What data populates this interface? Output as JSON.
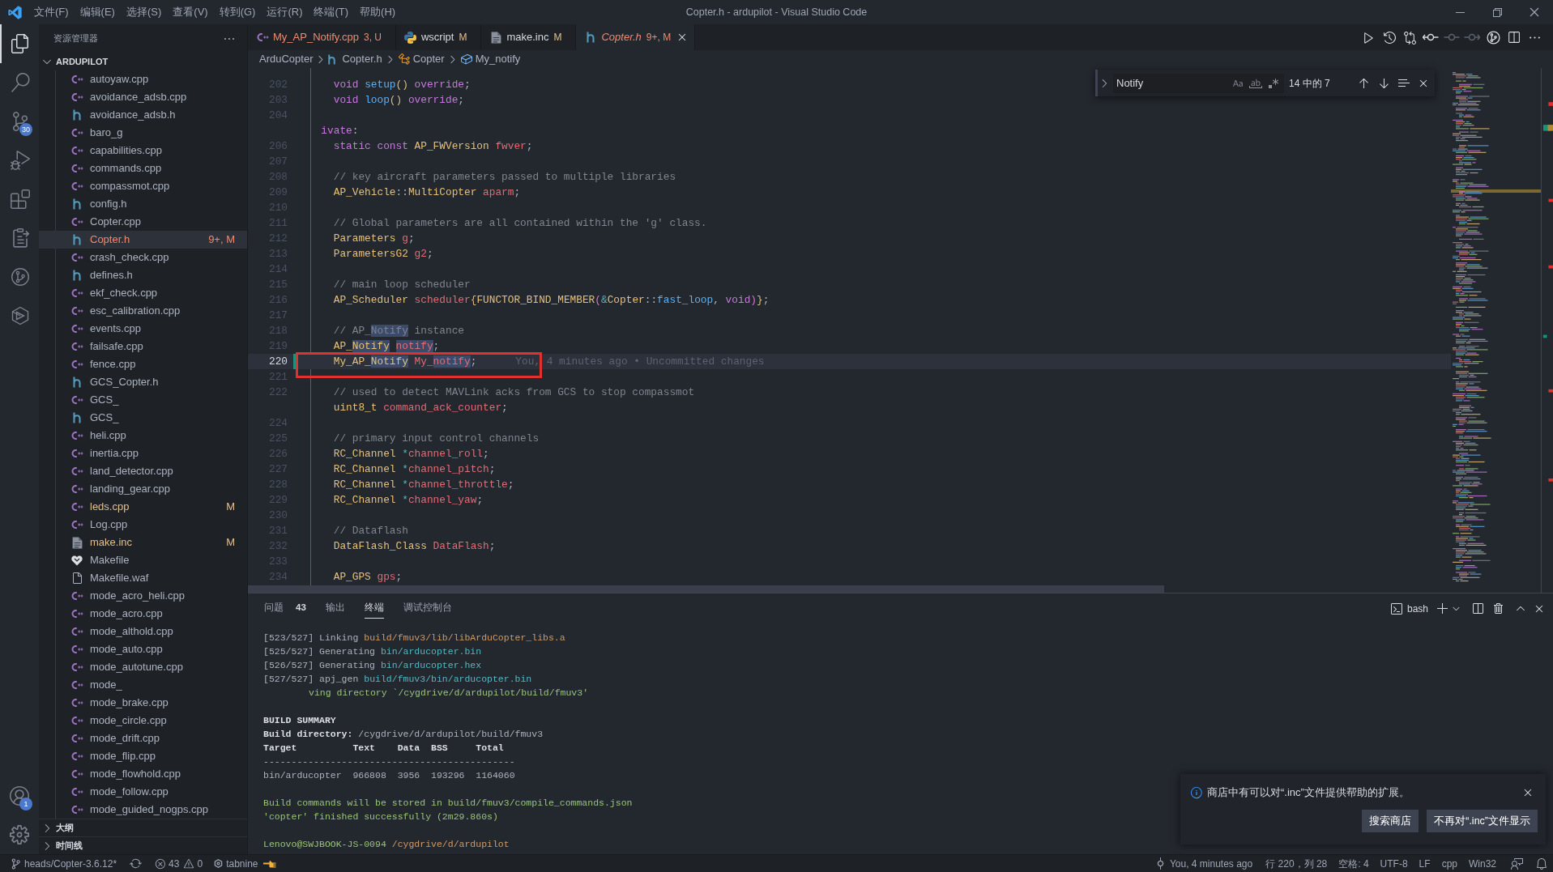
{
  "window": {
    "title": "Copter.h - ardupilot - Visual Studio Code",
    "menu": [
      "文件(F)",
      "编辑(E)",
      "选择(S)",
      "查看(V)",
      "转到(G)",
      "运行(R)",
      "终端(T)",
      "帮助(H)"
    ]
  },
  "activity_bar": {
    "items": [
      {
        "selected": true
      },
      {
        "selected": false
      },
      {
        "selected": false,
        "badge": "30"
      },
      {
        "selected": false
      },
      {
        "selected": false
      },
      {
        "selected": false
      },
      {
        "selected": false
      },
      {
        "selected": false
      }
    ],
    "account_badge": "1"
  },
  "explorer": {
    "title": "资源管理器",
    "folder": {
      "name": "ARDUPILOT",
      "expanded": true
    },
    "files": [
      {
        "name": "autoyaw.cpp",
        "kind": "cpp",
        "problems": false,
        "modified": false,
        "selected": false
      },
      {
        "name": "avoidance_adsb.cpp",
        "kind": "cpp",
        "problems": false,
        "modified": false,
        "selected": false
      },
      {
        "name": "avoidance_adsb.h",
        "kind": "h",
        "problems": false,
        "modified": false,
        "selected": false
      },
      {
        "name": "baro_g",
        "kind": "cpp",
        "problems": false,
        "modified": false,
        "selected": false
      },
      {
        "name": "capabilities.cpp",
        "kind": "cpp",
        "problems": false,
        "modified": false,
        "selected": false
      },
      {
        "name": "commands.cpp",
        "kind": "cpp",
        "problems": false,
        "modified": false,
        "selected": false
      },
      {
        "name": "compassmot.cpp",
        "kind": "cpp",
        "problems": false,
        "modified": false,
        "selected": false
      },
      {
        "name": "config.h",
        "kind": "h",
        "problems": false,
        "modified": false,
        "selected": false
      },
      {
        "name": "Copter.cpp",
        "kind": "cpp",
        "problems": false,
        "modified": false,
        "selected": false
      },
      {
        "name": "Copter.h",
        "kind": "h",
        "problems": true,
        "selected": true,
        "badge": "9+, M"
      },
      {
        "name": "crash_check.cpp",
        "kind": "cpp",
        "problems": false,
        "modified": false,
        "selected": false
      },
      {
        "name": "defines.h",
        "kind": "h",
        "problems": false,
        "modified": false,
        "selected": false
      },
      {
        "name": "ekf_check.cpp",
        "kind": "cpp",
        "problems": false,
        "modified": false,
        "selected": false
      },
      {
        "name": "esc_calibration.cpp",
        "kind": "cpp",
        "problems": false,
        "modified": false,
        "selected": false
      },
      {
        "name": "events.cpp",
        "kind": "cpp",
        "problems": false,
        "modified": false,
        "selected": false
      },
      {
        "name": "failsafe.cpp",
        "kind": "cpp",
        "problems": false,
        "modified": false,
        "selected": false
      },
      {
        "name": "fence.cpp",
        "kind": "cpp",
        "problems": false,
        "modified": false,
        "selected": false
      },
      {
        "name": "GCS_Copter.h",
        "kind": "h",
        "problems": false,
        "modified": false,
        "selected": false
      },
      {
        "name": "GCS_",
        "kind": "cpp",
        "problems": false,
        "modified": false,
        "selected": false
      },
      {
        "name": "GCS_",
        "kind": "h",
        "problems": false,
        "modified": false,
        "selected": false
      },
      {
        "name": "heli.cpp",
        "kind": "cpp",
        "problems": false,
        "modified": false,
        "selected": false
      },
      {
        "name": "inertia.cpp",
        "kind": "cpp",
        "problems": false,
        "modified": false,
        "selected": false
      },
      {
        "name": "land_detector.cpp",
        "kind": "cpp",
        "problems": false,
        "modified": false,
        "selected": false
      },
      {
        "name": "landing_gear.cpp",
        "kind": "cpp",
        "problems": false,
        "modified": false,
        "selected": false
      },
      {
        "name": "leds.cpp",
        "kind": "cpp",
        "problems": false,
        "modified": true,
        "selected": false,
        "badge": "M"
      },
      {
        "name": "Log.cpp",
        "kind": "cpp",
        "problems": false,
        "modified": false,
        "selected": false
      },
      {
        "name": "make.inc",
        "kind": "inc",
        "problems": false,
        "modified": true,
        "selected": false,
        "badge": "M"
      },
      {
        "name": "Makefile",
        "kind": "make",
        "problems": false,
        "modified": false,
        "selected": false
      },
      {
        "name": "Makefile.waf",
        "kind": "file",
        "problems": false,
        "modified": false,
        "selected": false
      },
      {
        "name": "mode_acro_heli.cpp",
        "kind": "cpp",
        "problems": false,
        "modified": false,
        "selected": false
      },
      {
        "name": "mode_acro.cpp",
        "kind": "cpp",
        "problems": false,
        "modified": false,
        "selected": false
      },
      {
        "name": "mode_althold.cpp",
        "kind": "cpp",
        "problems": false,
        "modified": false,
        "selected": false
      },
      {
        "name": "mode_auto.cpp",
        "kind": "cpp",
        "problems": false,
        "modified": false,
        "selected": false
      },
      {
        "name": "mode_autotune.cpp",
        "kind": "cpp",
        "problems": false,
        "modified": false,
        "selected": false
      },
      {
        "name": "mode_",
        "kind": "cpp",
        "problems": false,
        "modified": false,
        "selected": false
      },
      {
        "name": "mode_brake.cpp",
        "kind": "cpp",
        "problems": false,
        "modified": false,
        "selected": false
      },
      {
        "name": "mode_circle.cpp",
        "kind": "cpp",
        "problems": false,
        "modified": false,
        "selected": false
      },
      {
        "name": "mode_drift.cpp",
        "kind": "cpp",
        "problems": false,
        "modified": false,
        "selected": false
      },
      {
        "name": "mode_flip.cpp",
        "kind": "cpp",
        "problems": false,
        "modified": false,
        "selected": false
      },
      {
        "name": "mode_flowhold.cpp",
        "kind": "cpp",
        "problems": false,
        "modified": false,
        "selected": false
      },
      {
        "name": "mode_follow.cpp",
        "kind": "cpp",
        "problems": false,
        "modified": false,
        "selected": false
      },
      {
        "name": "mode_guided_nogps.cpp",
        "kind": "cpp",
        "problems": false,
        "modified": false,
        "selected": false
      }
    ],
    "sections": [
      {
        "label": "大纲",
        "expanded": false
      },
      {
        "label": "时间线",
        "expanded": false
      }
    ]
  },
  "tabs": [
    {
      "label": "My_AP_Notify.cpp",
      "decoration": "3, U",
      "kind": "cpp",
      "problems": true,
      "selected": false,
      "preview": false
    },
    {
      "label": "wscript",
      "decoration": "M",
      "kind": "python",
      "problems": false,
      "modified": true,
      "selected": false,
      "preview": false
    },
    {
      "label": "make.inc",
      "decoration": "M",
      "kind": "inc",
      "problems": false,
      "modified": true,
      "selected": false,
      "preview": false
    },
    {
      "label": "Copter.h",
      "decoration": "9+, M",
      "kind": "h",
      "problems": true,
      "selected": true,
      "preview": true
    }
  ],
  "editor_actions": [
    {
      "disabled": false
    },
    {
      "disabled": false
    },
    {
      "disabled": false
    },
    {
      "disabled": false
    },
    {
      "disabled": true
    },
    {
      "disabled": true
    },
    {
      "disabled": false
    },
    {
      "disabled": false
    },
    {
      "disabled": false
    }
  ],
  "breadcrumbs": [
    {
      "kind": "folder",
      "label": "ArduCopter"
    },
    {
      "kind": "header",
      "label": "Copter.h"
    },
    {
      "kind": "class",
      "label": "Copter"
    },
    {
      "kind": "field",
      "label": "My_notify"
    }
  ],
  "find": {
    "value": "Notify",
    "replace_expanded": false,
    "toggles": [
      {
        "on": false
      },
      {
        "on": false
      },
      {
        "on": false
      }
    ],
    "result": "14 中的 7"
  },
  "code": {
    "lines": [
      {
        "num": "202",
        "current": false,
        "modified": false,
        "tokens": [
          {
            "kind": "kw",
            "text": "    void ",
            "match": false
          },
          {
            "kind": "fn",
            "text": "setup",
            "match": false
          },
          {
            "kind": "br1",
            "text": "()",
            "match": false
          },
          {
            "kind": "kw",
            "text": " override",
            "match": false
          },
          {
            "kind": "p",
            "text": ";",
            "match": false
          }
        ]
      },
      {
        "num": "203",
        "current": false,
        "modified": false,
        "tokens": [
          {
            "kind": "kw",
            "text": "    void ",
            "match": false
          },
          {
            "kind": "fn",
            "text": "loop",
            "match": false
          },
          {
            "kind": "br1",
            "text": "()",
            "match": false
          },
          {
            "kind": "kw",
            "text": " override",
            "match": false
          },
          {
            "kind": "p",
            "text": ";",
            "match": false
          }
        ]
      },
      {
        "num": "204",
        "current": false,
        "modified": false
      },
      {
        "current": false,
        "modified": false,
        "tokens": [
          {
            "kind": "kw",
            "text": "  ivate",
            "match": false
          },
          {
            "kind": "p",
            "text": ":",
            "match": false
          }
        ]
      },
      {
        "num": "206",
        "current": false,
        "modified": false,
        "tokens": [
          {
            "kind": "kw",
            "text": "    static const ",
            "match": false
          },
          {
            "kind": "type",
            "text": "AP_FWVersion ",
            "match": false
          },
          {
            "kind": "var",
            "text": "fwver",
            "match": false
          },
          {
            "kind": "p",
            "text": ";",
            "match": false
          }
        ]
      },
      {
        "num": "207",
        "current": false,
        "modified": false
      },
      {
        "num": "208",
        "current": false,
        "modified": false,
        "tokens": [
          {
            "kind": "cm",
            "text": "    // key aircraft parameters passed to multiple libraries",
            "match": false
          }
        ]
      },
      {
        "num": "209",
        "current": false,
        "modified": false,
        "tokens": [
          {
            "kind": "type",
            "text": "    AP_Vehicle",
            "match": false
          },
          {
            "kind": "p",
            "text": "::",
            "match": false
          },
          {
            "kind": "type",
            "text": "MultiCopter ",
            "match": false
          },
          {
            "kind": "var",
            "text": "aparm",
            "match": false
          },
          {
            "kind": "p",
            "text": ";",
            "match": false
          }
        ]
      },
      {
        "num": "210",
        "current": false,
        "modified": false
      },
      {
        "num": "211",
        "current": false,
        "modified": false,
        "tokens": [
          {
            "kind": "cm",
            "text": "    // Global parameters are all contained within the 'g' class.",
            "match": false
          }
        ]
      },
      {
        "num": "212",
        "current": false,
        "modified": false,
        "tokens": [
          {
            "kind": "type",
            "text": "    Parameters ",
            "match": false
          },
          {
            "kind": "var",
            "text": "g",
            "match": false
          },
          {
            "kind": "p",
            "text": ";",
            "match": false
          }
        ]
      },
      {
        "num": "213",
        "current": false,
        "modified": false,
        "tokens": [
          {
            "kind": "type",
            "text": "    ParametersG2 ",
            "match": false
          },
          {
            "kind": "var",
            "text": "g2",
            "match": false
          },
          {
            "kind": "p",
            "text": ";",
            "match": false
          }
        ]
      },
      {
        "num": "214",
        "current": false,
        "modified": false
      },
      {
        "num": "215",
        "current": false,
        "modified": false,
        "tokens": [
          {
            "kind": "cm",
            "text": "    // main loop scheduler",
            "match": false
          }
        ]
      },
      {
        "num": "216",
        "current": false,
        "modified": false,
        "tokens": [
          {
            "kind": "type",
            "text": "    AP_Scheduler ",
            "match": false
          },
          {
            "kind": "var",
            "text": "scheduler",
            "match": false
          },
          {
            "kind": "br1",
            "text": "{",
            "match": false
          },
          {
            "kind": "type",
            "text": "FUNCTOR_BIND_MEMBER",
            "match": false
          },
          {
            "kind": "br2",
            "text": "(",
            "match": false
          },
          {
            "kind": "op",
            "text": "&",
            "match": false
          },
          {
            "kind": "type",
            "text": "Copter",
            "match": false
          },
          {
            "kind": "p",
            "text": "::",
            "match": false
          },
          {
            "kind": "fn",
            "text": "fast_loop",
            "match": false
          },
          {
            "kind": "p",
            "text": ", ",
            "match": false
          },
          {
            "kind": "kw",
            "text": "void",
            "match": false
          },
          {
            "kind": "br2",
            "text": ")",
            "match": false
          },
          {
            "kind": "br1",
            "text": "}",
            "match": false
          },
          {
            "kind": "p",
            "text": ";",
            "match": false
          }
        ]
      },
      {
        "num": "217",
        "current": false,
        "modified": false
      },
      {
        "num": "218",
        "current": false,
        "modified": false,
        "tokens": [
          {
            "kind": "cm",
            "text": "    // AP_",
            "match": false
          },
          {
            "kind": "cm",
            "text": "Notify",
            "match": true
          },
          {
            "kind": "cm",
            "text": " instance",
            "match": false
          }
        ]
      },
      {
        "num": "219",
        "current": false,
        "modified": false,
        "tokens": [
          {
            "kind": "type",
            "text": "    AP_",
            "match": false
          },
          {
            "kind": "type",
            "text": "Notify",
            "match": true
          },
          {
            "kind": "var",
            "text": " notify",
            "match": true
          },
          {
            "kind": "p",
            "text": ";",
            "match": false
          }
        ]
      },
      {
        "num": "220",
        "current": true,
        "modified": true,
        "tokens": [
          {
            "kind": "type",
            "text": "    My_AP_",
            "match": false
          },
          {
            "kind": "type",
            "text": "Notify",
            "match": true
          },
          {
            "kind": "var",
            "text": " My_",
            "match": false
          },
          {
            "kind": "var",
            "text": "notify",
            "match": true
          },
          {
            "kind": "p",
            "text": ";",
            "match": false
          }
        ],
        "blame": "You, 4 minutes ago • Uncommitted changes"
      },
      {
        "num": "221",
        "current": false,
        "modified": false
      },
      {
        "num": "222",
        "current": false,
        "modified": false,
        "tokens": [
          {
            "kind": "cm",
            "text": "    // used to detect MAVLink acks from GCS to stop compassmot",
            "match": false
          }
        ]
      },
      {
        "current": false,
        "modified": false,
        "tokens": [
          {
            "kind": "type",
            "text": "    uint8_t ",
            "match": false
          },
          {
            "kind": "var",
            "text": "command_ack_counter",
            "match": false
          },
          {
            "kind": "p",
            "text": ";",
            "match": false
          }
        ]
      },
      {
        "num": "224",
        "current": false,
        "modified": false
      },
      {
        "num": "225",
        "current": false,
        "modified": false,
        "tokens": [
          {
            "kind": "cm",
            "text": "    // primary input control channels",
            "match": false
          }
        ]
      },
      {
        "num": "226",
        "current": false,
        "modified": false,
        "tokens": [
          {
            "kind": "type",
            "text": "    RC_Channel ",
            "match": false
          },
          {
            "kind": "op",
            "text": "*",
            "match": false
          },
          {
            "kind": "var",
            "text": "channel_roll",
            "match": false
          },
          {
            "kind": "p",
            "text": ";",
            "match": false
          }
        ]
      },
      {
        "num": "227",
        "current": false,
        "modified": false,
        "tokens": [
          {
            "kind": "type",
            "text": "    RC_Channel ",
            "match": false
          },
          {
            "kind": "op",
            "text": "*",
            "match": false
          },
          {
            "kind": "var",
            "text": "channel_pitch",
            "match": false
          },
          {
            "kind": "p",
            "text": ";",
            "match": false
          }
        ]
      },
      {
        "num": "228",
        "current": false,
        "modified": false,
        "tokens": [
          {
            "kind": "type",
            "text": "    RC_Channel ",
            "match": false
          },
          {
            "kind": "op",
            "text": "*",
            "match": false
          },
          {
            "kind": "var",
            "text": "channel_throttle",
            "match": false
          },
          {
            "kind": "p",
            "text": ";",
            "match": false
          }
        ]
      },
      {
        "num": "229",
        "current": false,
        "modified": false,
        "tokens": [
          {
            "kind": "type",
            "text": "    RC_Channel ",
            "match": false
          },
          {
            "kind": "op",
            "text": "*",
            "match": false
          },
          {
            "kind": "var",
            "text": "channel_yaw",
            "match": false
          },
          {
            "kind": "p",
            "text": ";",
            "match": false
          }
        ]
      },
      {
        "num": "230",
        "current": false,
        "modified": false
      },
      {
        "num": "231",
        "current": false,
        "modified": false,
        "tokens": [
          {
            "kind": "cm",
            "text": "    // Dataflash",
            "match": false
          }
        ]
      },
      {
        "num": "232",
        "current": false,
        "modified": false,
        "tokens": [
          {
            "kind": "type",
            "text": "    DataFlash_Class ",
            "match": false
          },
          {
            "kind": "var",
            "text": "DataFlash",
            "match": false
          },
          {
            "kind": "p",
            "text": ";",
            "match": false
          }
        ]
      },
      {
        "num": "233",
        "current": false,
        "modified": false
      },
      {
        "num": "234",
        "current": false,
        "modified": false,
        "tokens": [
          {
            "kind": "type",
            "text": "    AP_GPS ",
            "match": false
          },
          {
            "kind": "var",
            "text": "gps",
            "match": false
          },
          {
            "kind": "p",
            "text": ";",
            "match": false
          }
        ]
      }
    ]
  },
  "panel": {
    "tabs": [
      {
        "label": "问题",
        "count": "43",
        "selected": false
      },
      {
        "label": "输出",
        "selected": false
      },
      {
        "label": "终端",
        "selected": true
      },
      {
        "label": "调试控制台",
        "selected": false
      }
    ],
    "shell": "bash",
    "terminal": [
      {
        "kind": "text",
        "segments": [
          {
            "kind": "plain",
            "text": "[523/527] Linking "
          },
          {
            "kind": "orange",
            "text": "build/fmuv3/lib/libArduCopter_libs.a"
          }
        ]
      },
      {
        "kind": "text",
        "segments": [
          {
            "kind": "plain",
            "text": "[525/527] Generating "
          },
          {
            "kind": "cyan",
            "text": "bin/arducopter.bin"
          }
        ]
      },
      {
        "kind": "text",
        "segments": [
          {
            "kind": "plain",
            "text": "[526/527] Generating "
          },
          {
            "kind": "cyan",
            "text": "bin/arducopter.hex"
          }
        ]
      },
      {
        "kind": "text",
        "segments": [
          {
            "kind": "plain",
            "text": "[527/527] apj_gen "
          },
          {
            "kind": "cyan",
            "text": "build/fmuv3/bin/arducopter.bin"
          }
        ]
      },
      {
        "kind": "partial",
        "segments": [
          {
            "kind": "green",
            "text": "ving directory `/cygdrive/d/ardupilot/build/fmuv3'"
          }
        ]
      },
      {
        "kind": "blank"
      },
      {
        "kind": "text",
        "segments": [
          {
            "kind": "bold",
            "text": "BUILD SUMMARY"
          }
        ]
      },
      {
        "kind": "text",
        "segments": [
          {
            "kind": "bold",
            "text": "Build directory:"
          },
          {
            "kind": "plain",
            "text": " /cygdrive/d/ardupilot/build/fmuv3"
          }
        ]
      },
      {
        "kind": "text",
        "segments": [
          {
            "kind": "bold",
            "text": "Target          Text    Data  BSS     Total"
          }
        ]
      },
      {
        "kind": "text",
        "segments": [
          {
            "kind": "plain",
            "text": "---------------------------------------------"
          }
        ]
      },
      {
        "kind": "text",
        "segments": [
          {
            "kind": "plain",
            "text": "bin/arducopter  966808  3956  193296  1164060"
          }
        ]
      },
      {
        "kind": "blank"
      },
      {
        "kind": "text",
        "segments": [
          {
            "kind": "green",
            "text": "Build commands will be stored in build/fmuv3/compile_commands.json"
          }
        ]
      },
      {
        "kind": "text",
        "segments": [
          {
            "kind": "green",
            "text": "'copter' finished successfully (2m29.860s)"
          }
        ]
      },
      {
        "kind": "blank"
      },
      {
        "kind": "text",
        "segments": [
          {
            "kind": "green",
            "text": "Lenovo@SWJBOOK-JS-0094 "
          },
          {
            "kind": "orange",
            "text": "/cygdrive/d/ardupilot"
          }
        ]
      }
    ]
  },
  "notification": {
    "message": "商店中有可以对“.inc”文件提供帮助的扩展。",
    "buttons": [
      "搜索商店",
      "不再对“.inc”文件显示"
    ]
  },
  "status_bar": {
    "branch": "heads/Copter-3.6.12*",
    "errors": "43",
    "warnings": "0",
    "tabnine": "tabnine",
    "blame": "You, 4 minutes ago",
    "position": "行 220，列 28",
    "indent": "空格: 4",
    "encoding": "UTF-8",
    "eol": "LF",
    "language": "cpp",
    "platform": "Win32"
  }
}
